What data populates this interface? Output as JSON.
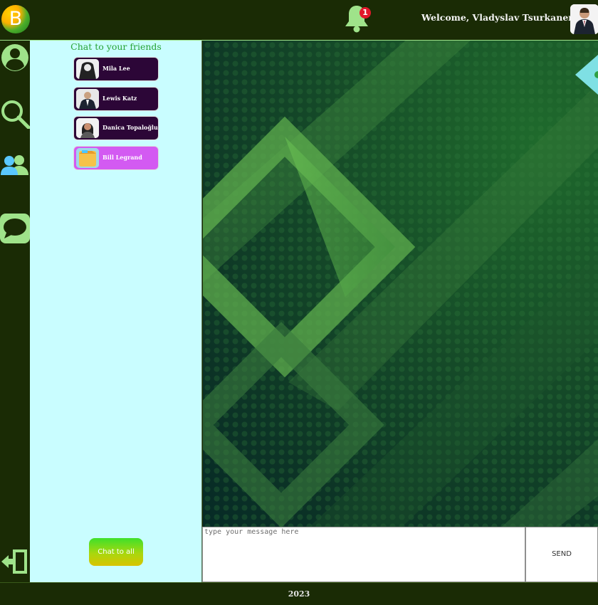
{
  "header": {
    "logo_letter": "B",
    "notification_count": "1",
    "welcome_text": "Welcome, Vladyslav Tsurkanenko"
  },
  "rail": {
    "icons": [
      "profile-icon",
      "search-icon",
      "friends-icon",
      "chat-icon",
      "logout-icon"
    ]
  },
  "friends_panel": {
    "title": "Chat to your friends",
    "friends": [
      {
        "name": "Mila Lee",
        "active": false
      },
      {
        "name": "Lewis Katz",
        "active": false
      },
      {
        "name": "Danica Topaloğlu",
        "active": false
      },
      {
        "name": "Bill Legrand",
        "active": true
      }
    ],
    "chat_all_label": "Chat to all"
  },
  "composer": {
    "placeholder": "type your message here",
    "value": "",
    "send_label": "SEND"
  },
  "footer": {
    "year": "2023"
  },
  "colors": {
    "header_bg": "#1a2b05",
    "accent_green": "#9fe38a",
    "panel_bg": "#c9fdff",
    "friend_bg": "#2c0637",
    "friend_active_bg": "#d35af2",
    "badge_red": "#e2172b"
  }
}
